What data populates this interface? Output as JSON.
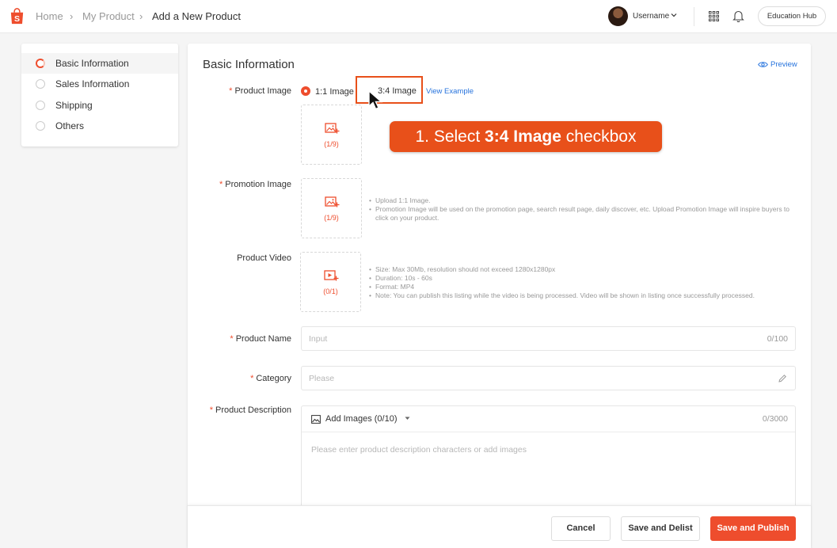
{
  "header": {
    "breadcrumbs": [
      "Home",
      "My Product",
      "Add a New Product"
    ],
    "username": "Username",
    "education_hub": "Education Hub"
  },
  "sidebar": {
    "items": [
      {
        "label": "Basic Information",
        "active": true
      },
      {
        "label": "Sales Information",
        "active": false
      },
      {
        "label": "Shipping",
        "active": false
      },
      {
        "label": "Others",
        "active": false
      }
    ]
  },
  "main": {
    "title": "Basic Information",
    "preview_label": "Preview",
    "product_image": {
      "label": "Product Image",
      "option_1": "1:1 Image",
      "option_2": "3:4 Image",
      "selected": "1:1 Image",
      "view_example": "View Example",
      "count": "(1/9)"
    },
    "promotion_image": {
      "label": "Promotion Image",
      "count": "(1/9)",
      "hints": [
        "Upload 1:1 Image.",
        "Promotion Image will be used on the promotion page, search result page, daily discover, etc. Upload Promotion Image will inspire buyers to click on your product."
      ]
    },
    "product_video": {
      "label": "Product Video",
      "count": "(0/1)",
      "hints": [
        "Size: Max 30Mb, resolution should not exceed 1280x1280px",
        "Duration: 10s - 60s",
        "Format: MP4",
        "Note: You can publish this listing while the video is being processed. Video will be shown in listing once successfully processed."
      ]
    },
    "product_name": {
      "label": "Product Name",
      "placeholder": "Input",
      "counter": "0/100"
    },
    "category": {
      "label": "Category",
      "placeholder": "Please"
    },
    "product_description": {
      "label": "Product Description",
      "add_images": "Add Images (0/10)",
      "counter": "0/3000",
      "placeholder": "Please enter product description characters or add images"
    }
  },
  "annotation": {
    "prefix": "1. Select ",
    "bold": "3:4 Image",
    "suffix": " checkbox"
  },
  "footer": {
    "cancel": "Cancel",
    "save_delist": "Save and Delist",
    "save_publish": "Save and Publish"
  },
  "colors": {
    "brand": "#ee4d2d",
    "link": "#2673dd",
    "annotation": "#e8501a"
  }
}
